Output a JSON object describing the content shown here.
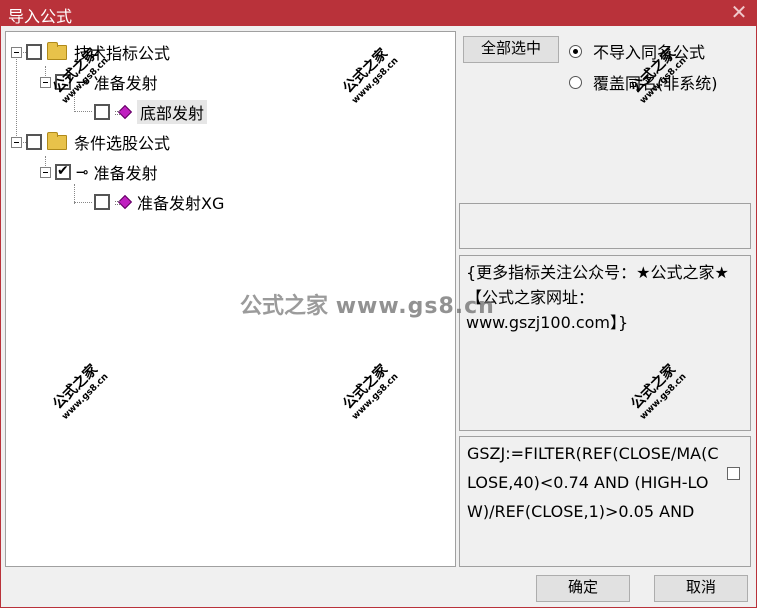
{
  "window": {
    "title": "导入公式",
    "close_glyph": "✕"
  },
  "tree": {
    "nodes": [
      {
        "label": "技术指标公式",
        "icon": "folder-icon",
        "checked": false
      },
      {
        "label": "准备发射",
        "icon": "key-icon",
        "checked": false
      },
      {
        "label": "底部发射",
        "icon": "gem-icon",
        "checked": false,
        "highlighted": true
      },
      {
        "label": "条件选股公式",
        "icon": "folder-icon",
        "checked": false
      },
      {
        "label": "准备发射",
        "icon": "key-icon",
        "checked": true
      },
      {
        "label": "准备发射XG",
        "icon": "gem-icon",
        "checked": false
      }
    ]
  },
  "options": {
    "select_all_label": "全部选中",
    "radio_no_import_label": "不导入同名公式",
    "radio_overwrite_label": "覆盖同名(非系统)",
    "selected": "不导入同名公式"
  },
  "description": {
    "text": "{更多指标关注公众号：★公式之家★ 【公式之家网址：www.gszj100.com】}"
  },
  "formula": {
    "text": "GSZJ:=FILTER(REF(CLOSE/MA(CLOSE,40)<0.74 AND (HIGH-LOW)/REF(CLOSE,1)>0.05 AND"
  },
  "footer": {
    "ok_label": "确定",
    "cancel_label": "取消"
  },
  "watermark": {
    "big_cn": "公式之家",
    "big_url": "www.gs8.cn",
    "stamp_cn": "公式之家",
    "stamp_url": "www.gs8.cn"
  },
  "colors": {
    "titlebar": "#b9323a",
    "gem": "#c020c0",
    "folder": "#e8c24a"
  }
}
